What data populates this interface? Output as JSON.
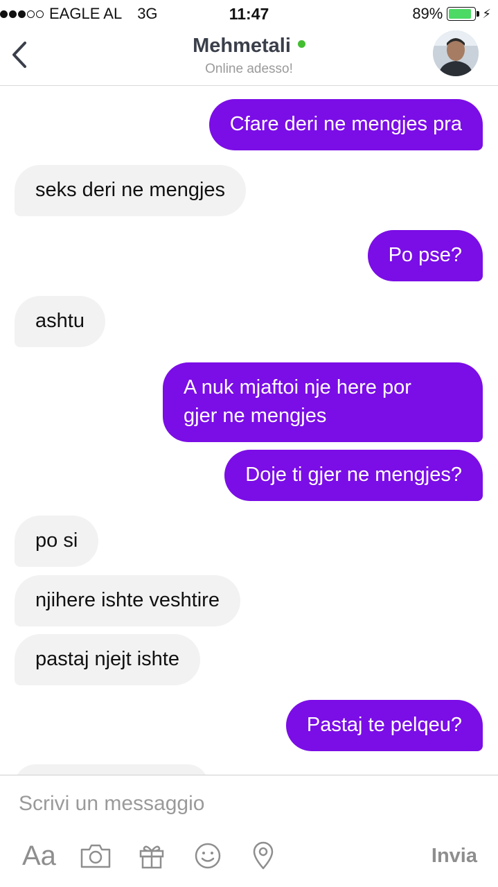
{
  "status_bar": {
    "carrier": "EAGLE AL",
    "network": "3G",
    "time": "11:47",
    "battery": "89%",
    "battery_level": 0.89,
    "signal_bars": 3
  },
  "header": {
    "contact_name": "Mehmetali",
    "status": "Online adesso!",
    "online_color": "#44bd32"
  },
  "colors": {
    "sent_bubble": "#7b0de6",
    "received_bubble": "#f2f2f2"
  },
  "messages": [
    {
      "direction": "sent",
      "text": "Cfare deri ne mengjes pra"
    },
    {
      "direction": "received",
      "text": "seks deri ne mengjes"
    },
    {
      "direction": "sent",
      "text": "Po pse?"
    },
    {
      "direction": "received",
      "text": "ashtu"
    },
    {
      "direction": "sent",
      "lines": [
        "A nuk mjaftoi nje here por",
        "gjer ne mengjes"
      ]
    },
    {
      "direction": "sent",
      "text": "Doje ti gjer ne mengjes?"
    },
    {
      "direction": "received",
      "text": "po si"
    },
    {
      "direction": "received",
      "text": "njihere ishte veshtire"
    },
    {
      "direction": "received",
      "text": "pastaj njejt ishte"
    },
    {
      "direction": "sent",
      "text": "Pastaj te pelqeu?"
    }
  ],
  "composer": {
    "placeholder": "Scrivi un messaggio",
    "text_format_label": "Aa",
    "send_label": "Invia",
    "icons": [
      "camera-icon",
      "gift-icon",
      "emoji-icon",
      "location-pin-icon"
    ]
  }
}
